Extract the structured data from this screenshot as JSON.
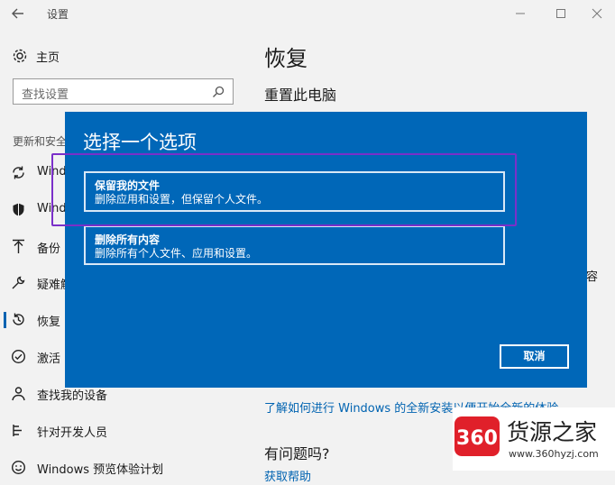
{
  "window": {
    "title": "设置"
  },
  "sidebar": {
    "home_label": "主页",
    "search_placeholder": "查找设置",
    "section_label": "更新和安全",
    "items": [
      {
        "label": "Windo",
        "icon": "sync-icon"
      },
      {
        "label": "Windo",
        "icon": "shield-icon"
      },
      {
        "label": "备份",
        "icon": "backup-arrow-icon"
      },
      {
        "label": "疑难解",
        "icon": "wrench-icon"
      },
      {
        "label": "恢复",
        "icon": "history-icon",
        "active": true
      },
      {
        "label": "激活",
        "icon": "check-circle-icon"
      },
      {
        "label": "查找我的设备",
        "icon": "person-location-icon"
      },
      {
        "label": "针对开发人员",
        "icon": "developer-icon"
      },
      {
        "label": "Windows 预览体验计划",
        "icon": "smiley-icon"
      }
    ]
  },
  "main": {
    "title": "恢复",
    "subtitle": "重置此电脑",
    "right_fragment": "容",
    "learn_link": "了解如何进行 Windows 的全新安装以便开始全新的体验",
    "question": "有问题吗?",
    "help_link": "获取帮助"
  },
  "dialog": {
    "title": "选择一个选项",
    "options": [
      {
        "title": "保留我的文件",
        "desc": "删除应用和设置，但保留个人文件。"
      },
      {
        "title": "删除所有内容",
        "desc": "删除所有个人文件、应用和设置。"
      }
    ],
    "cancel_label": "取消"
  },
  "watermark": {
    "badge": "360",
    "text": "货源之家",
    "url": "www.360hyzj.com"
  },
  "colors": {
    "dialog_bg": "#0067b8",
    "accent": "#0063b1",
    "highlight": "#7b2fc9",
    "watermark_red": "#e0202a"
  }
}
